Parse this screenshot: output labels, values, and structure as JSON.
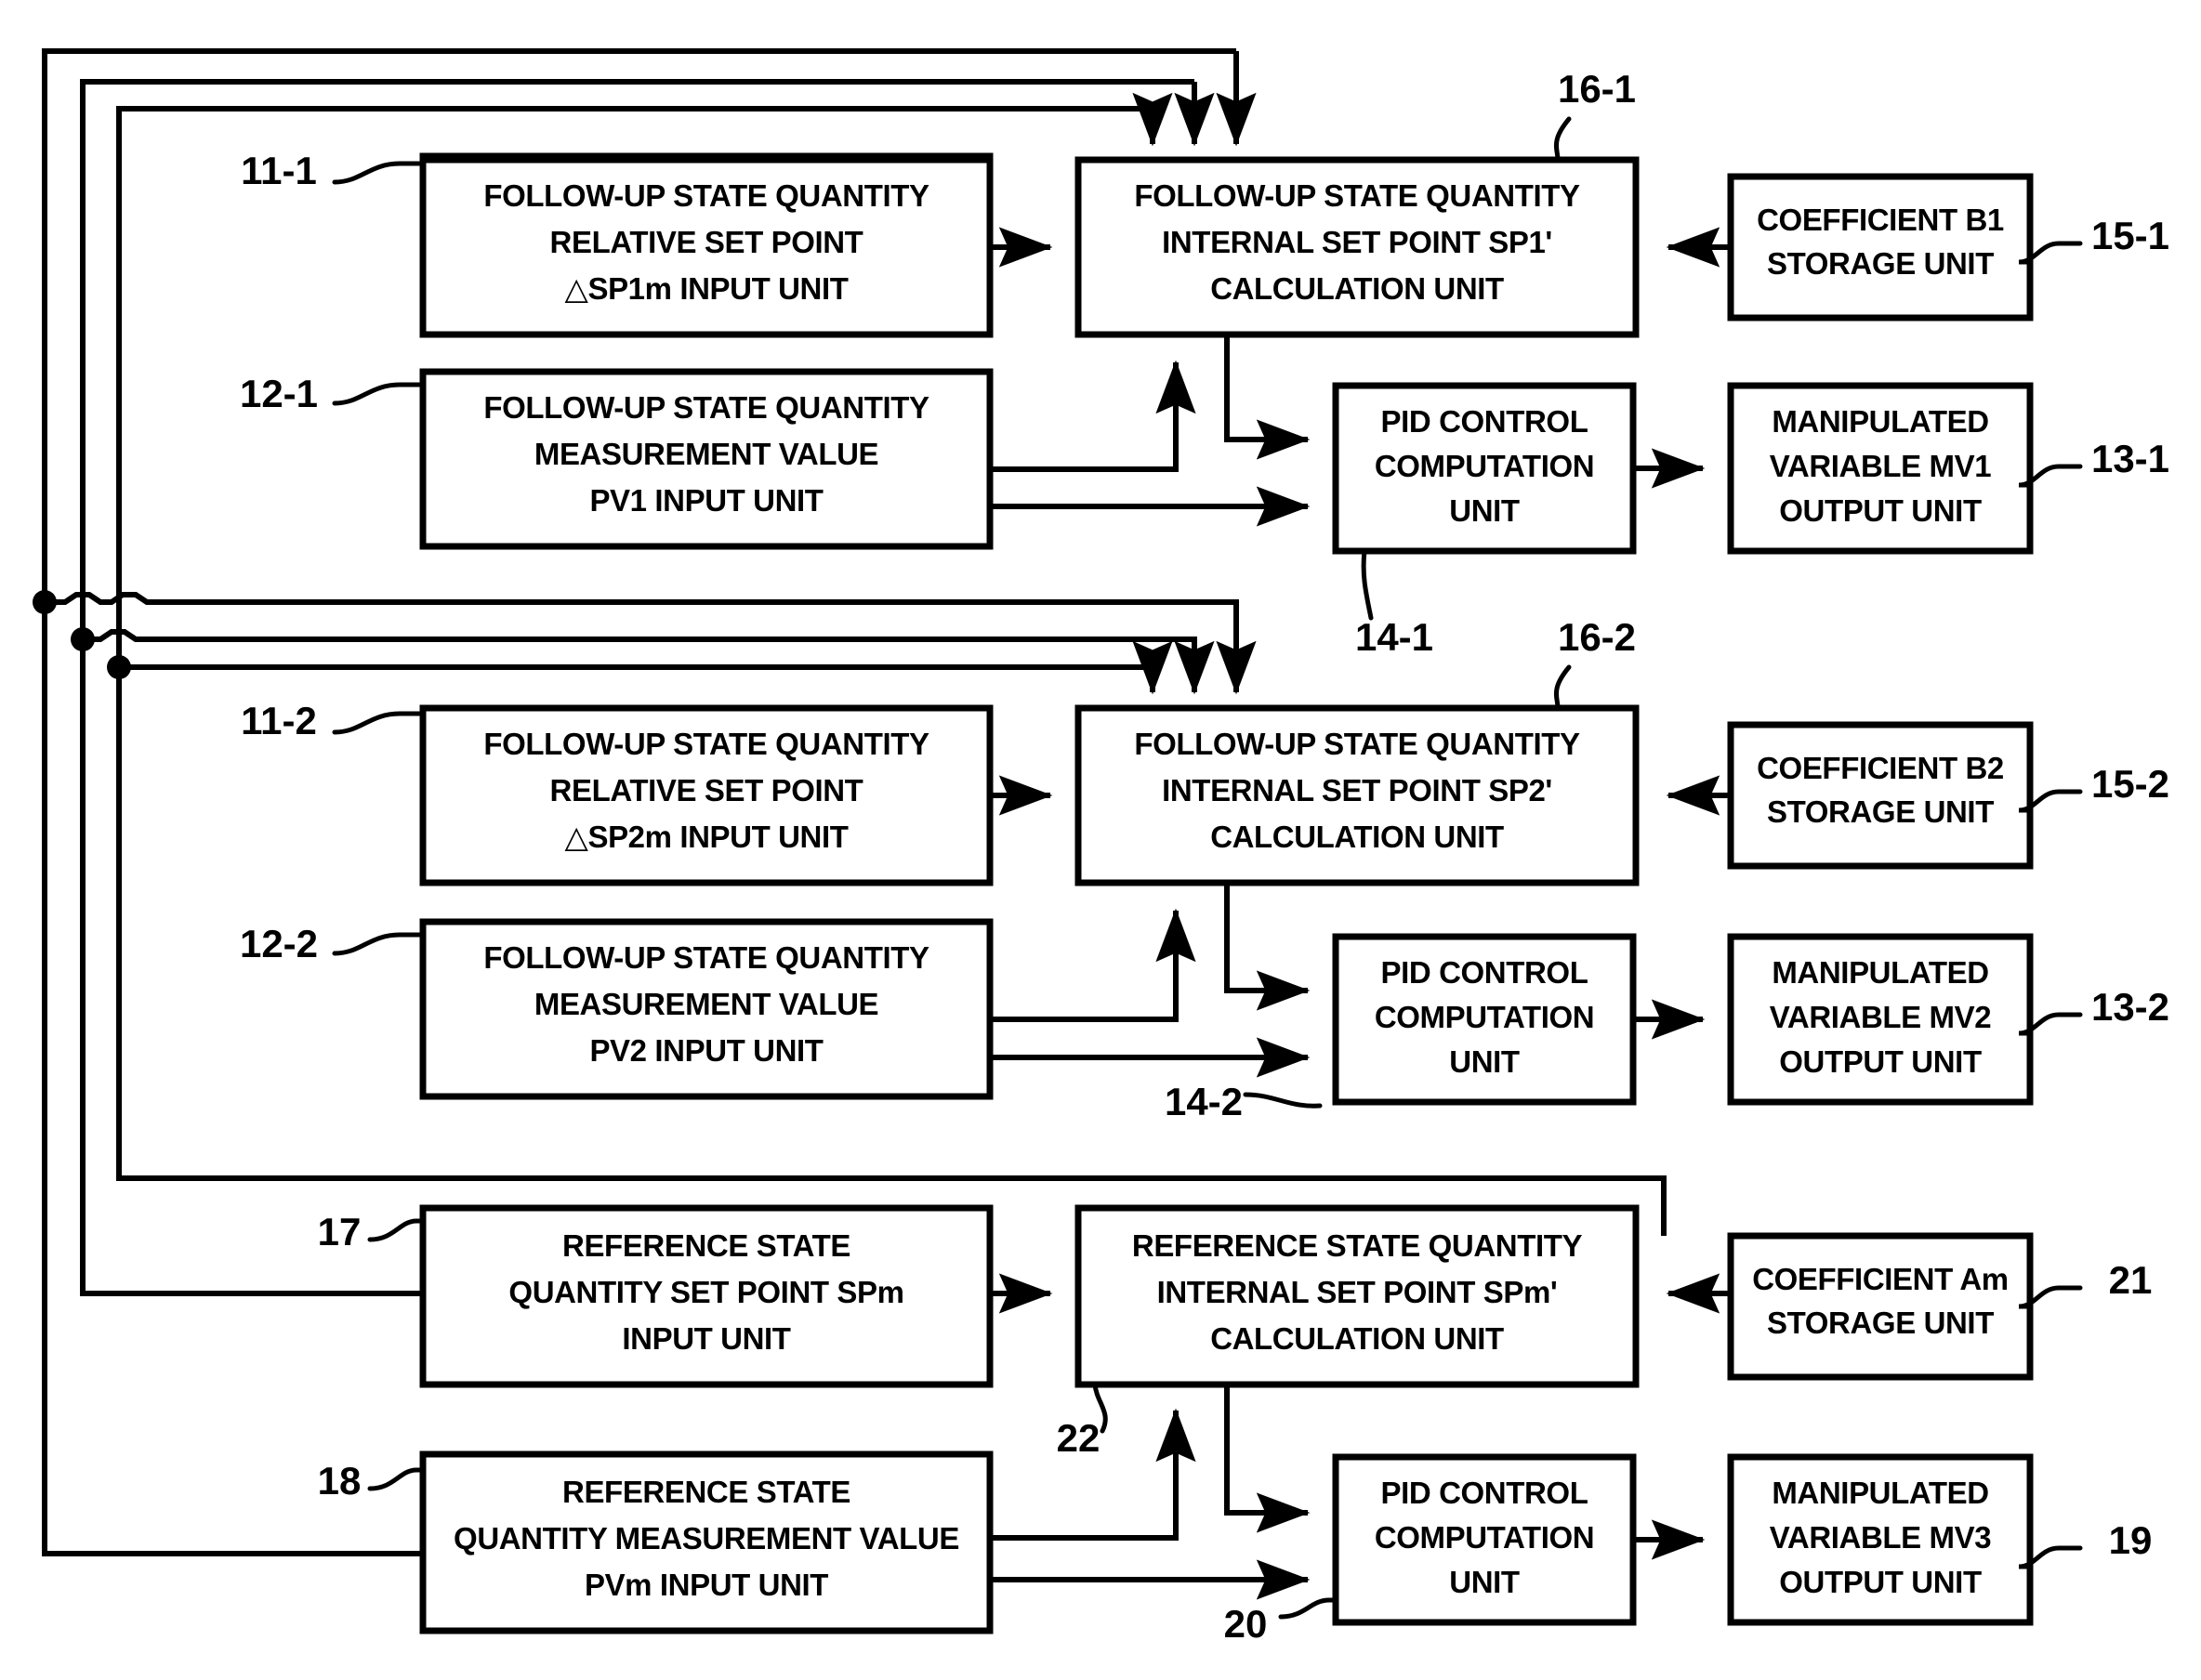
{
  "diagram": {
    "title": "Cascade follow-up / reference state quantity control block diagram",
    "background_color": "#ffffff",
    "line_color": "#000000",
    "boxes": [
      {
        "id": "11-1",
        "ref": "11-1",
        "lines": [
          "FOLLOW-UP STATE QUANTITY",
          "RELATIVE SET POINT",
          "△SP1m INPUT UNIT"
        ]
      },
      {
        "id": "16-1",
        "ref": "16-1",
        "lines": [
          "FOLLOW-UP STATE QUANTITY",
          "INTERNAL SET POINT SP1'",
          "CALCULATION UNIT"
        ]
      },
      {
        "id": "15-1",
        "ref": "15-1",
        "lines": [
          "COEFFICIENT B1",
          "STORAGE UNIT"
        ]
      },
      {
        "id": "12-1",
        "ref": "12-1",
        "lines": [
          "FOLLOW-UP STATE QUANTITY",
          "MEASUREMENT VALUE",
          "PV1 INPUT UNIT"
        ]
      },
      {
        "id": "14-1",
        "ref": "14-1",
        "lines": [
          "PID CONTROL",
          "COMPUTATION",
          "UNIT"
        ]
      },
      {
        "id": "13-1",
        "ref": "13-1",
        "lines": [
          "MANIPULATED",
          "VARIABLE MV1",
          "OUTPUT UNIT"
        ]
      },
      {
        "id": "11-2",
        "ref": "11-2",
        "lines": [
          "FOLLOW-UP STATE QUANTITY",
          "RELATIVE SET POINT",
          "△SP2m INPUT UNIT"
        ]
      },
      {
        "id": "16-2",
        "ref": "16-2",
        "lines": [
          "FOLLOW-UP STATE QUANTITY",
          "INTERNAL SET POINT SP2'",
          "CALCULATION UNIT"
        ]
      },
      {
        "id": "15-2",
        "ref": "15-2",
        "lines": [
          "COEFFICIENT B2",
          "STORAGE UNIT"
        ]
      },
      {
        "id": "12-2",
        "ref": "12-2",
        "lines": [
          "FOLLOW-UP STATE QUANTITY",
          "MEASUREMENT VALUE",
          "PV2 INPUT UNIT"
        ]
      },
      {
        "id": "14-2",
        "ref": "14-2",
        "lines": [
          "PID CONTROL",
          "COMPUTATION",
          "UNIT"
        ]
      },
      {
        "id": "13-2",
        "ref": "13-2",
        "lines": [
          "MANIPULATED",
          "VARIABLE MV2",
          "OUTPUT UNIT"
        ]
      },
      {
        "id": "17",
        "ref": "17",
        "lines": [
          "REFERENCE STATE",
          "QUANTITY SET POINT SPm",
          "INPUT UNIT"
        ]
      },
      {
        "id": "22",
        "ref": "22",
        "lines": [
          "REFERENCE STATE QUANTITY",
          "INTERNAL SET POINT SPm'",
          "CALCULATION UNIT"
        ]
      },
      {
        "id": "21",
        "ref": "21",
        "lines": [
          "COEFFICIENT Am",
          "STORAGE UNIT"
        ]
      },
      {
        "id": "18",
        "ref": "18",
        "lines": [
          "REFERENCE STATE",
          "QUANTITY MEASUREMENT VALUE",
          "PVm INPUT UNIT"
        ]
      },
      {
        "id": "20",
        "ref": "20",
        "lines": [
          "PID CONTROL",
          "COMPUTATION",
          "UNIT"
        ]
      },
      {
        "id": "19",
        "ref": "19",
        "lines": [
          "MANIPULATED",
          "VARIABLE MV3",
          "OUTPUT UNIT"
        ]
      }
    ],
    "reference_numerals": [
      "11-1",
      "12-1",
      "13-1",
      "14-1",
      "15-1",
      "16-1",
      "11-2",
      "12-2",
      "13-2",
      "14-2",
      "15-2",
      "16-2",
      "17",
      "18",
      "19",
      "20",
      "21",
      "22"
    ]
  }
}
